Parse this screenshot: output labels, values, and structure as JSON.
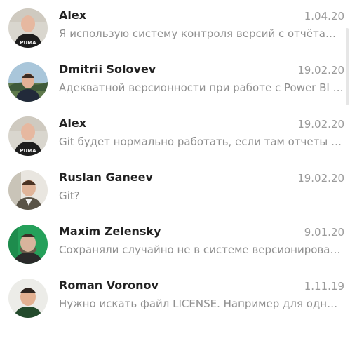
{
  "chats": [
    {
      "name": "Alex",
      "date": "1.04.20",
      "preview": "Я использую систему контроля версий с отчётами мне удобно",
      "avatar": "person-avatar-icon"
    },
    {
      "name": "Dmitrii Solovev",
      "date": "19.02.20",
      "preview": "Адекватной версионности при работе с Power BI D...",
      "avatar": "person-avatar-icon"
    },
    {
      "name": "Alex",
      "date": "19.02.20",
      "preview": "Git будет нормально работать, если там отчеты на...",
      "avatar": "person-avatar-icon"
    },
    {
      "name": "Ruslan Ganeev",
      "date": "19.02.20",
      "preview": "Git?",
      "avatar": "person-avatar-icon"
    },
    {
      "name": "Maxim Zelensky",
      "date": "9.01.20",
      "preview": "Сохраняли случайно не в системе версионирован...",
      "avatar": "person-avatar-icon"
    },
    {
      "name": "Roman Voronov",
      "date": "1.11.19",
      "preview": "Нужно искать файл LICENSE. Например для одной ...",
      "avatar": "person-avatar-icon"
    }
  ],
  "avatar_text": "PUMA",
  "colors": {
    "name": "#222222",
    "date": "#9a9a9a",
    "preview": "#8f8f8f",
    "background": "#ffffff"
  }
}
